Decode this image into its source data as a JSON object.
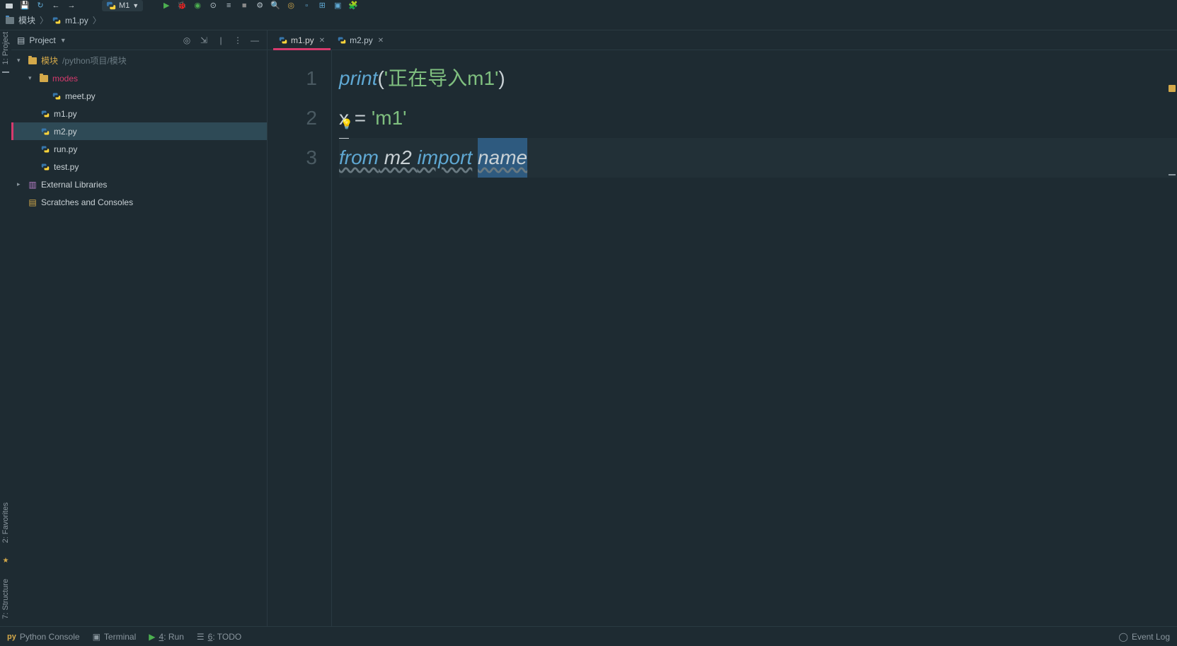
{
  "toolbar": {
    "run_config": "M1"
  },
  "breadcrumb": {
    "folder": "模块",
    "file": "m1.py"
  },
  "left_stripe": {
    "project": "1: Project",
    "favorites": "2: Favorites",
    "structure": "7: Structure"
  },
  "sidebar": {
    "header_label": "Project",
    "root": {
      "label": "模块",
      "path": "/python项目/模块"
    },
    "modes": {
      "label": "modes"
    },
    "files": [
      "meet.py",
      "m1.py",
      "m2.py",
      "run.py",
      "test.py"
    ],
    "external": "External Libraries",
    "scratches": "Scratches and Consoles"
  },
  "tabs": [
    {
      "label": "m1.py",
      "active": true
    },
    {
      "label": "m2.py",
      "active": false
    }
  ],
  "editor": {
    "gutter": [
      "1",
      "2",
      "3"
    ],
    "line1": {
      "func": "print",
      "open": "(",
      "str": "'正在导入m1'",
      "close": ")"
    },
    "line2": {
      "var": "x",
      "op": " = ",
      "str": "'m1'"
    },
    "line3": {
      "kw1": "from",
      "mod": " m2 ",
      "kw2": "import",
      "sp": " ",
      "name": "name"
    }
  },
  "bottom": {
    "python_console": "Python Console",
    "terminal": "Terminal",
    "run": "4: Run",
    "todo": "6: TODO",
    "event_log": "Event Log"
  }
}
